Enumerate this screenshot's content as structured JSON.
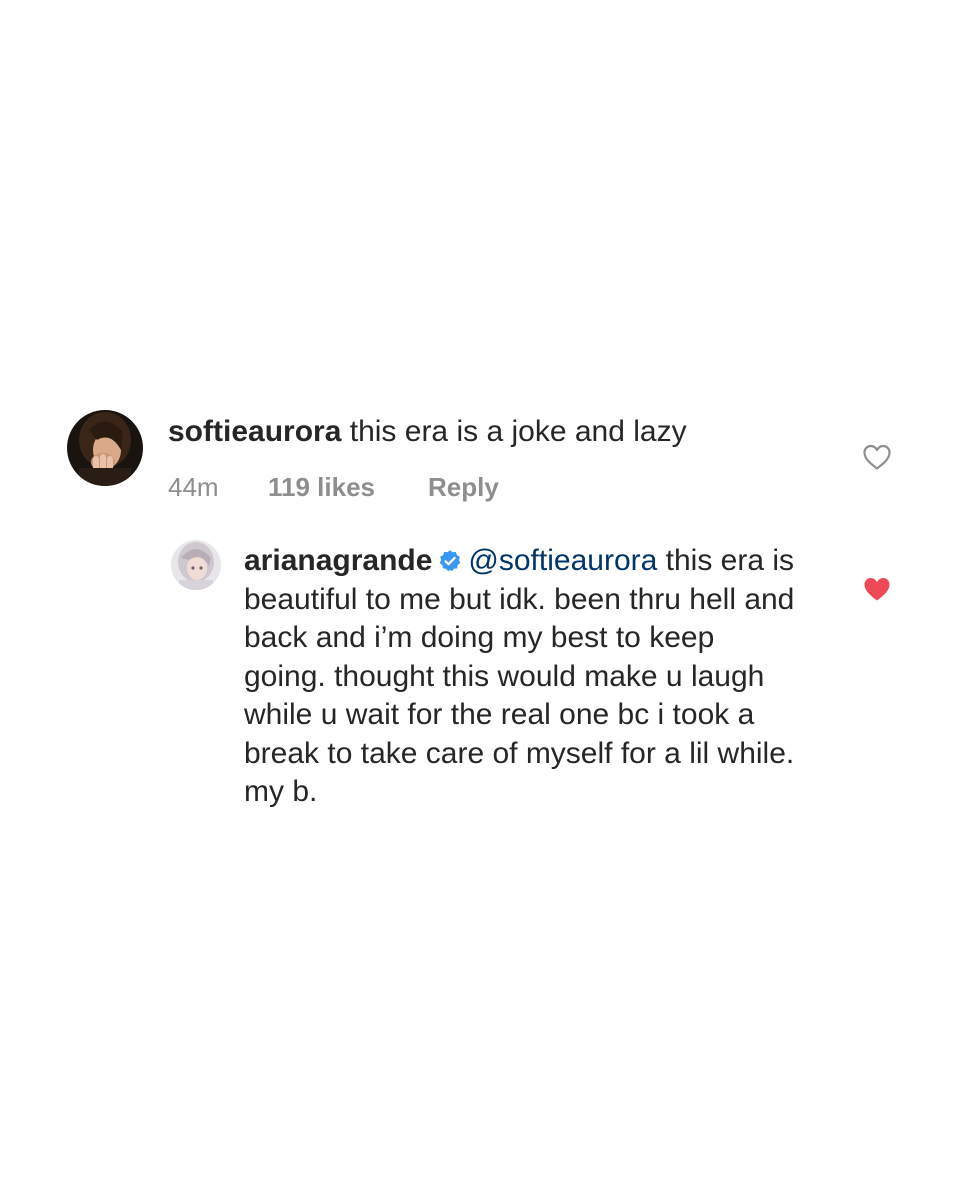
{
  "comments": [
    {
      "username": "softieaurora",
      "text": "this era is a joke and lazy",
      "time": "44m",
      "likes": "119 likes",
      "reply_label": "Reply",
      "avatar_icon": "profile-photo",
      "like_icon": "heart-outline-icon",
      "liked": false
    },
    {
      "username": "arianagrande",
      "verified": true,
      "badge_icon": "verified-badge-icon",
      "badge_color": "#3897f0",
      "mention": "@softieaurora",
      "text": "this era is beautiful to me but idk. been thru hell and back and i’m doing my best to keep going. thought this would make u laugh while u wait for the real one bc i took a break to take care of myself for a lil while. my b.",
      "avatar_icon": "profile-photo",
      "like_icon": "heart-filled-icon",
      "liked": true,
      "like_color": "#ed4956"
    }
  ],
  "colors": {
    "text": "#262626",
    "meta": "#8e8e8e",
    "mention": "#003569",
    "heart_outline": "#8e8e8e"
  }
}
